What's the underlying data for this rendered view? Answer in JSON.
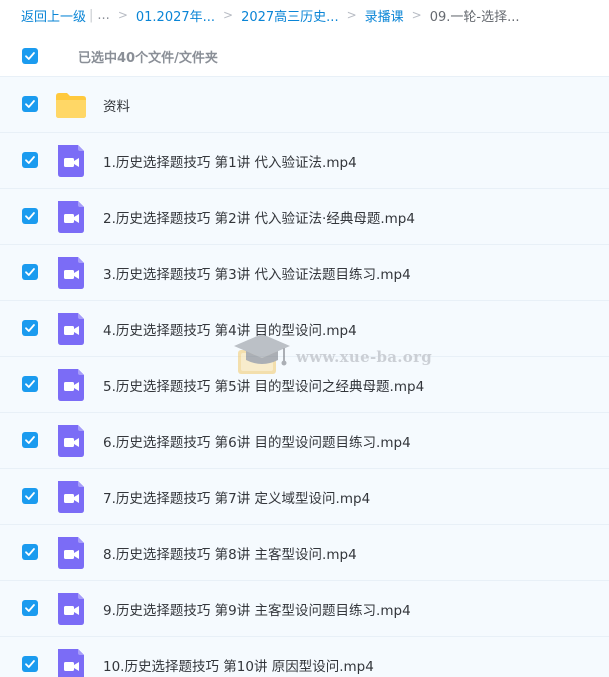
{
  "breadcrumb": {
    "back_label": "返回上一级",
    "ellipsis": "...",
    "separator": ">",
    "items": [
      {
        "label": "01.2027年..."
      },
      {
        "label": "2027高三历史..."
      },
      {
        "label": "录播课"
      }
    ],
    "current": "09.一轮-选择..."
  },
  "selection": {
    "summary": "已选中40个文件/文件夹",
    "checked": true
  },
  "files": [
    {
      "name": "资料",
      "type": "folder",
      "checked": true
    },
    {
      "name": "1.历史选择题技巧 第1讲 代入验证法.mp4",
      "type": "video",
      "checked": true
    },
    {
      "name": "2.历史选择题技巧 第2讲 代入验证法·经典母题.mp4",
      "type": "video",
      "checked": true
    },
    {
      "name": "3.历史选择题技巧 第3讲 代入验证法题目练习.mp4",
      "type": "video",
      "checked": true
    },
    {
      "name": "4.历史选择题技巧 第4讲 目的型设问.mp4",
      "type": "video",
      "checked": true
    },
    {
      "name": "5.历史选择题技巧 第5讲 目的型设问之经典母题.mp4",
      "type": "video",
      "checked": true
    },
    {
      "name": "6.历史选择题技巧 第6讲 目的型设问题目练习.mp4",
      "type": "video",
      "checked": true
    },
    {
      "name": "7.历史选择题技巧 第7讲 定义域型设问.mp4",
      "type": "video",
      "checked": true
    },
    {
      "name": "8.历史选择题技巧 第8讲 主客型设问.mp4",
      "type": "video",
      "checked": true
    },
    {
      "name": "9.历史选择题技巧 第9讲 主客型设问题目练习.mp4",
      "type": "video",
      "checked": true
    },
    {
      "name": "10.历史选择题技巧 第10讲 原因型设问.mp4",
      "type": "video",
      "checked": true
    }
  ],
  "watermark": {
    "text": "www.xue-ba.org",
    "icon": "graduation-cap-icon"
  },
  "colors": {
    "link": "#0a85d6",
    "checkbox": "#1b9bef",
    "row_background": "#f5fafe",
    "video_icon": "#7b6cf6",
    "folder_icon": "#ffc93d"
  }
}
